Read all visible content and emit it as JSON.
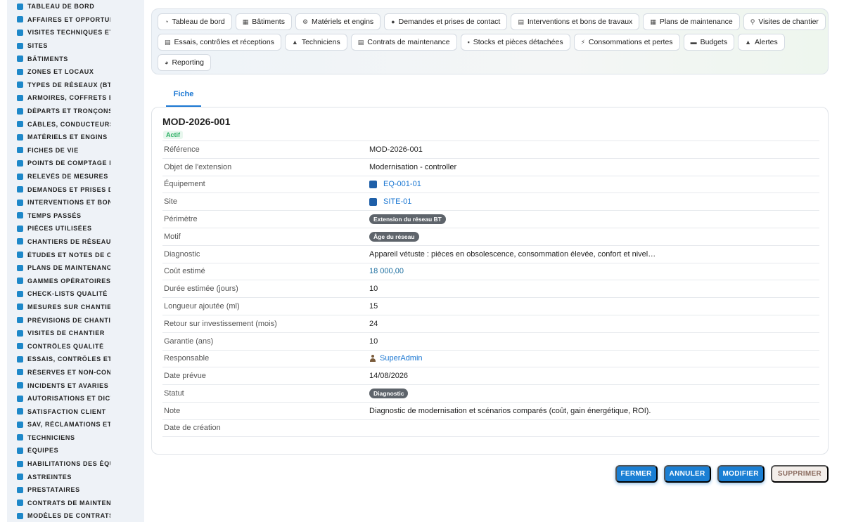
{
  "sidebar": {
    "items": [
      {
        "label": "TABLEAU DE BORD",
        "icon": "dashboard-icon"
      },
      {
        "label": "AFFAIRES ET OPPORTUNITÉS",
        "icon": "target-icon"
      },
      {
        "label": "VISITES TECHNIQUES ET RELEVÉS",
        "icon": "clipboard-icon"
      },
      {
        "label": "SITES",
        "icon": "map-pin-icon"
      },
      {
        "label": "BÂTIMENTS",
        "icon": "building-icon"
      },
      {
        "label": "ZONES ET LOCAUX",
        "icon": "grid-icon"
      },
      {
        "label": "TYPES DE RÉSEAUX (BT / HTA)",
        "icon": "network-icon"
      },
      {
        "label": "ARMOIRES, COFFRETS ET TABLEAUX",
        "icon": "cabinet-icon"
      },
      {
        "label": "DÉPARTS ET TRONÇONS",
        "icon": "branch-icon"
      },
      {
        "label": "CÂBLES, CONDUCTEURS",
        "icon": "cable-icon"
      },
      {
        "label": "MATÉRIELS ET ENGINS",
        "icon": "gears-icon"
      },
      {
        "label": "FICHES DE VIE",
        "icon": "history-icon"
      },
      {
        "label": "POINTS DE COMPTAGE ET MESURES",
        "icon": "gauge-icon"
      },
      {
        "label": "RELEVÉS DE MESURES",
        "icon": "list-icon"
      },
      {
        "label": "DEMANDES ET PRISES DE CONTACT",
        "icon": "question-icon"
      },
      {
        "label": "INTERVENTIONS ET BONS DE TRAVAUX",
        "icon": "wrench-icon"
      },
      {
        "label": "TEMPS PASSÉS",
        "icon": "clock-icon"
      },
      {
        "label": "PIÈCES UTILISÉES",
        "icon": "parts-icon"
      },
      {
        "label": "CHANTIERS DE RÉSEAUX",
        "icon": "hammer-icon"
      },
      {
        "label": "ÉTUDES ET NOTES DE CALCUL",
        "icon": "document-icon"
      },
      {
        "label": "PLANS DE MAINTENANCE",
        "icon": "calendar-icon"
      },
      {
        "label": "GAMMES OPÉRATOIRES",
        "icon": "layers-icon"
      },
      {
        "label": "CHECK-LISTS QUALITÉ",
        "icon": "checklist-icon"
      },
      {
        "label": "MESURES SUR CHANTIER",
        "icon": "thermometer-icon"
      },
      {
        "label": "PRÉVISIONS DE CHANTIER",
        "icon": "chart-icon"
      },
      {
        "label": "VISITES DE CHANTIER",
        "icon": "visit-icon"
      },
      {
        "label": "CONTRÔLES QUALITÉ",
        "icon": "search-icon"
      },
      {
        "label": "ESSAIS, CONTRÔLES ET RÉCEPTIONS",
        "icon": "test-icon"
      },
      {
        "label": "RÉSERVES ET NON-CONFORMITÉS",
        "icon": "info-icon"
      },
      {
        "label": "INCIDENTS ET AVARIES",
        "icon": "warning-icon"
      },
      {
        "label": "AUTORISATIONS ET DICT",
        "icon": "permit-icon"
      },
      {
        "label": "SATISFACTION CLIENT",
        "icon": "smile-icon"
      },
      {
        "label": "SAV, RÉCLAMATIONS ET GARANTIES",
        "icon": "chat-icon"
      },
      {
        "label": "TECHNICIENS",
        "icon": "helmet-icon"
      },
      {
        "label": "ÉQUIPES",
        "icon": "users-icon"
      },
      {
        "label": "HABILITATIONS DES ÉQUIPES",
        "icon": "badge-icon"
      },
      {
        "label": "ASTREINTES",
        "icon": "phone-icon"
      },
      {
        "label": "PRESTATAIRES",
        "icon": "handshake-icon"
      },
      {
        "label": "CONTRATS DE MAINTENANCE",
        "icon": "contract-icon"
      },
      {
        "label": "MODÈLES DE CONTRATS",
        "icon": "template-icon"
      }
    ]
  },
  "nav": {
    "row1": [
      {
        "label": "Tableau de bord",
        "icon": "dashboard-icon"
      },
      {
        "label": "Bâtiments",
        "icon": "building-icon"
      },
      {
        "label": "Matériels et engins",
        "icon": "gears-icon"
      },
      {
        "label": "Demandes et prises de contact",
        "icon": "question-icon"
      },
      {
        "label": "Interventions et bons de travaux",
        "icon": "wrench-icon"
      },
      {
        "label": "Plans de maintenance",
        "icon": "calendar-icon"
      },
      {
        "label": "Visites de chantier",
        "icon": "visit-icon"
      }
    ],
    "row2": [
      {
        "label": "Essais, contrôles et réceptions",
        "icon": "test-icon"
      },
      {
        "label": "Techniciens",
        "icon": "helmet-icon"
      },
      {
        "label": "Contrats de maintenance",
        "icon": "contract-icon"
      },
      {
        "label": "Stocks et pièces détachées",
        "icon": "boxes-icon"
      },
      {
        "label": "Consommations et pertes",
        "icon": "bolt-icon"
      },
      {
        "label": "Budgets",
        "icon": "money-icon"
      },
      {
        "label": "Alertes",
        "icon": "bell-icon"
      }
    ],
    "row3": [
      {
        "label": "Reporting",
        "icon": "pie-icon"
      }
    ]
  },
  "tabs": {
    "fiche": "Fiche"
  },
  "record": {
    "title": "MOD-2026-001",
    "status": "Actif",
    "fields": [
      {
        "label": "Référence",
        "value": "MOD-2026-001",
        "kind": "text"
      },
      {
        "label": "Objet de l'extension",
        "value": "Modernisation - controller",
        "kind": "text"
      },
      {
        "label": "Équipement",
        "value": "EQ-001-01",
        "kind": "link"
      },
      {
        "label": "Site",
        "value": "SITE-01",
        "kind": "link"
      },
      {
        "label": "Périmètre",
        "value": "Extension du réseau BT",
        "kind": "chip"
      },
      {
        "label": "Motif",
        "value": "Âge du réseau",
        "kind": "chip"
      },
      {
        "label": "Diagnostic",
        "value": "Appareil vétuste : pièces en obsolescence, consommation élevée, confort et nivel…",
        "kind": "text"
      },
      {
        "label": "Coût estimé",
        "value": "18 000,00",
        "kind": "num"
      },
      {
        "label": "Durée estimée (jours)",
        "value": "10",
        "kind": "text"
      },
      {
        "label": "Longueur ajoutée (ml)",
        "value": "15",
        "kind": "text"
      },
      {
        "label": "Retour sur investissement (mois)",
        "value": "24",
        "kind": "text"
      },
      {
        "label": "Garantie (ans)",
        "value": "10",
        "kind": "text"
      },
      {
        "label": "Responsable",
        "value": "SuperAdmin",
        "kind": "user"
      },
      {
        "label": "Date prévue",
        "value": "14/08/2026",
        "kind": "text"
      },
      {
        "label": "Statut",
        "value": "Diagnostic",
        "kind": "chip"
      },
      {
        "label": "Note",
        "value": "Diagnostic de modernisation et scénarios comparés (coût, gain énergétique, ROI).",
        "kind": "text"
      },
      {
        "label": "Date de création",
        "value": "",
        "kind": "text"
      }
    ]
  },
  "actions": {
    "close": "FERMER",
    "cancel": "ANNULER",
    "edit": "MODIFIER",
    "delete": "SUPPRIMER"
  },
  "colors": {
    "accent": "#1a7fd4",
    "active_badge": "#27ae60",
    "chip": "#5e646b"
  }
}
